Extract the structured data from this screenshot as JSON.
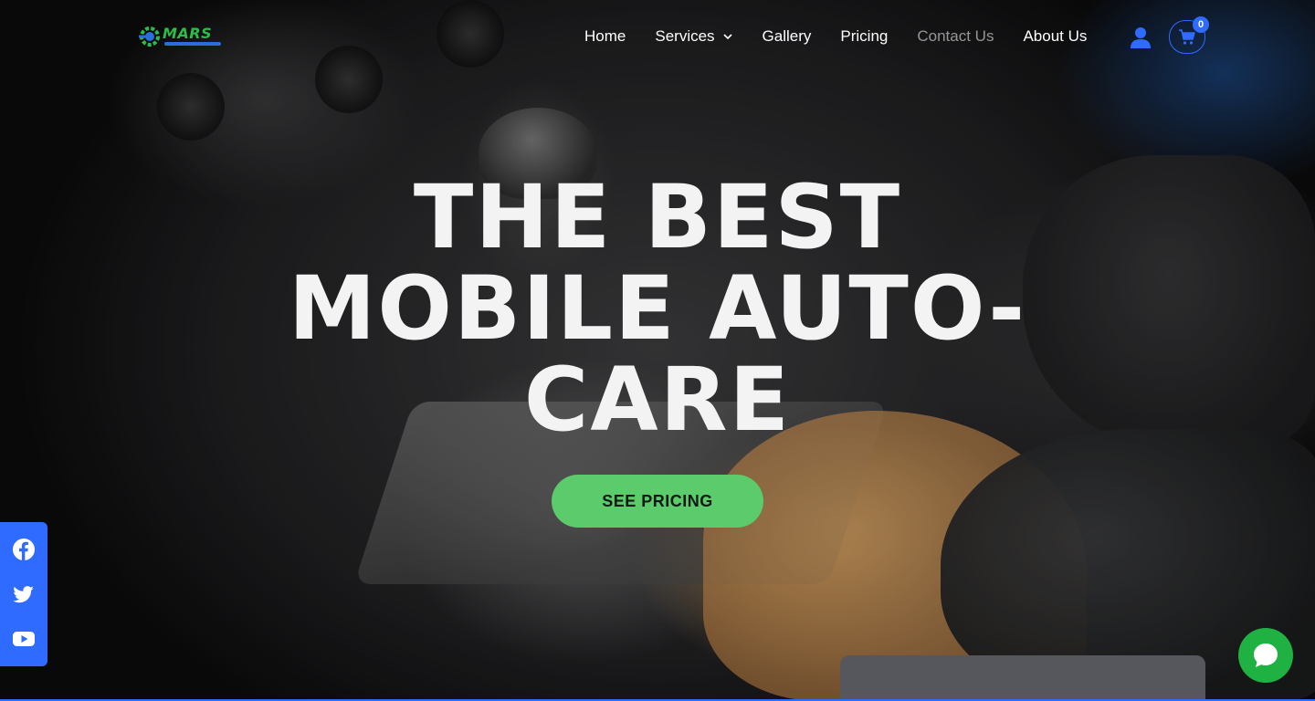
{
  "logo": {
    "text": "MARS"
  },
  "nav": {
    "items": [
      {
        "label": "Home"
      },
      {
        "label": "Services",
        "has_dropdown": true
      },
      {
        "label": "Gallery"
      },
      {
        "label": "Pricing"
      },
      {
        "label": "Contact Us"
      },
      {
        "label": "About Us"
      }
    ]
  },
  "cart": {
    "count": "0"
  },
  "hero": {
    "headline_lines": [
      "THE BEST",
      "MOBILE AUTO-",
      "CARE"
    ],
    "cta_label": "SEE PRICING"
  },
  "social": [
    {
      "icon": "facebook-icon"
    },
    {
      "icon": "twitter-icon"
    },
    {
      "icon": "youtube-icon"
    }
  ],
  "colors": {
    "accent_blue": "#2f6bff",
    "cta_green": "#5ccb6c",
    "chat_green": "#1fb141",
    "logo_green": "#2dbb4a"
  }
}
